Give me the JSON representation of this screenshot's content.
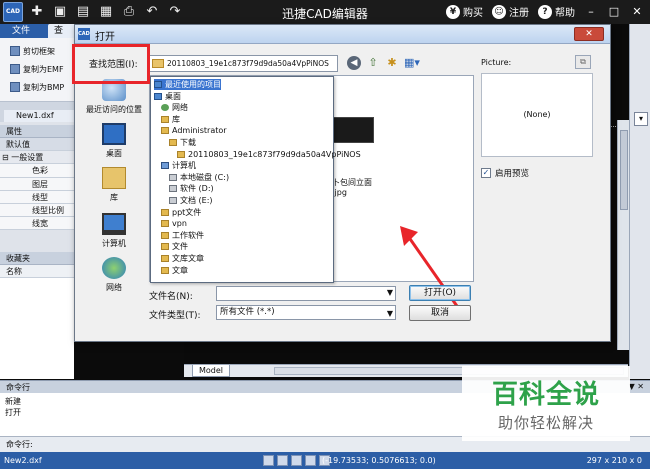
{
  "app": {
    "title": "迅捷CAD编辑器",
    "logo_text": "CAD",
    "right_links": {
      "buy": "购买",
      "register": "注册",
      "help": "帮助"
    },
    "quick_icons": [
      "new-file-icon",
      "folder-icon",
      "save-icon",
      "save-as-icon",
      "print-icon",
      "undo-icon",
      "redo-icon"
    ]
  },
  "left_panel": {
    "tabs": {
      "file": "文件",
      "view": "查看"
    },
    "ribbon_items": [
      "剪切框架",
      "复制为EMF",
      "复制为BMP"
    ],
    "doc_tab": "New1.dxf",
    "properties_header": "属性",
    "properties_rows": {
      "default": "默认值",
      "general": "一般设置",
      "color": "色彩",
      "layer": "图层",
      "linetype": "线型",
      "linescale": "线型比例",
      "linewidth": "线宽"
    },
    "favorites_header": "收藏夹",
    "favorites_name_col": "名称"
  },
  "canvas": {
    "model_tab": "Model"
  },
  "command": {
    "header": "命令行",
    "pin": "▼ ✕",
    "lines": [
      "新建",
      "打开"
    ],
    "input_label": "命令行:"
  },
  "status": {
    "doc": "New2.dxf",
    "coords": "(-19.73533; 0.5076613; 0.0)",
    "size": "297 x 210 x 0"
  },
  "watermark": {
    "title": "百科全说",
    "subtitle": "助你轻松解决"
  },
  "dialog": {
    "title": "打开",
    "look_in_label": "查找范围(I):",
    "look_in_value": "20110803_19e1c873f79d9da50a4VpPiNOS",
    "places": [
      {
        "label": "最近访问的位置",
        "icon": "recent-places-icon"
      },
      {
        "label": "桌面",
        "icon": "desktop-icon"
      },
      {
        "label": "库",
        "icon": "library-icon"
      },
      {
        "label": "计算机",
        "icon": "computer-icon"
      },
      {
        "label": "网络",
        "icon": "network-icon"
      }
    ],
    "dropdown_items": [
      {
        "label": "最近使用的项目",
        "icon": "ic-blue",
        "indent": 0,
        "selected": true
      },
      {
        "label": "桌面",
        "icon": "ic-blue",
        "indent": 0
      },
      {
        "label": "网络",
        "icon": "ic-net",
        "indent": 1
      },
      {
        "label": "库",
        "icon": "ic-folder",
        "indent": 1
      },
      {
        "label": "Administrator",
        "icon": "ic-folder",
        "indent": 1
      },
      {
        "label": "下载",
        "icon": "ic-folder",
        "indent": 2
      },
      {
        "label": "20110803_19e1c873f79d9da50a4VpPiNOS",
        "icon": "ic-folder",
        "indent": 3
      },
      {
        "label": "计算机",
        "icon": "ic-pc",
        "indent": 1
      },
      {
        "label": "本地磁盘 (C:)",
        "icon": "ic-drive",
        "indent": 2
      },
      {
        "label": "软件 (D:)",
        "icon": "ic-drive",
        "indent": 2
      },
      {
        "label": "文档 (E:)",
        "icon": "ic-drive",
        "indent": 2
      },
      {
        "label": "ppt文件",
        "icon": "ic-folder",
        "indent": 1
      },
      {
        "label": "vpn",
        "icon": "ic-folder",
        "indent": 1
      },
      {
        "label": "工作软件",
        "icon": "ic-folder",
        "indent": 1
      },
      {
        "label": "文件",
        "icon": "ic-folder",
        "indent": 1
      },
      {
        "label": "文库文章",
        "icon": "ic-folder",
        "indent": 1
      },
      {
        "label": "文章",
        "icon": "ic-folder",
        "indent": 1
      }
    ],
    "thumb_label": "卜包间立面\n.jpg",
    "file_name_label": "文件名(N):",
    "file_name_value": "",
    "file_type_label": "文件类型(T):",
    "file_type_value": "所有文件 (*.*)",
    "open_button": "打开(O)",
    "cancel_button": "取消",
    "picture_label": "Picture:",
    "picture_none": "(None)",
    "enable_preview": "启用预览",
    "enable_preview_checked": true,
    "accent_colors": {
      "highlight_box": "#e8252a",
      "selection": "#3a74d0"
    }
  }
}
